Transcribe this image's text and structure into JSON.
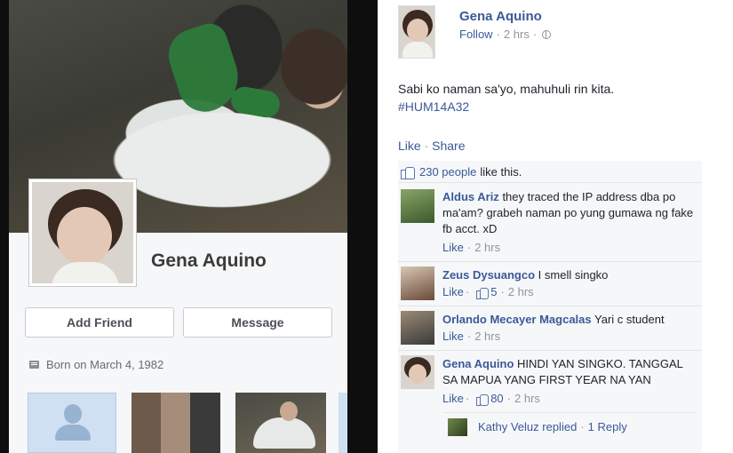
{
  "profile": {
    "name": "Gena Aquino",
    "add_friend": "Add Friend",
    "message": "Message",
    "born": "Born on March 4, 1982"
  },
  "post": {
    "author": "Gena Aquino",
    "follow": "Follow",
    "separator": "·",
    "time": "2 hrs",
    "text": "Sabi ko naman sa'yo, mahuhuli rin kita.",
    "hashtag": "#HUM14A32",
    "like": "Like",
    "share": "Share"
  },
  "likes": {
    "count": "230 people",
    "suffix": "like this."
  },
  "comments": [
    {
      "name": "Aldus Ariz",
      "text": "they traced the IP address dba po ma'am? grabeh naman po yung gumawa ng fake fb acct. xD",
      "like": "Like",
      "time": "2 hrs",
      "likes": ""
    },
    {
      "name": "Zeus Dysuangco",
      "text": "I smell singko",
      "like": "Like",
      "time": "2 hrs",
      "likes": "5"
    },
    {
      "name": "Orlando Mecayer Magcalas",
      "text": "Yari c student",
      "like": "Like",
      "time": "2 hrs",
      "likes": ""
    },
    {
      "name": "Gena Aquino",
      "text": "HINDI YAN SINGKO. TANGGAL SA MAPUA YANG FIRST YEAR NA YAN",
      "like": "Like",
      "time": "2 hrs",
      "likes": "80"
    }
  ],
  "reply": {
    "text": "Kathy Veluz replied",
    "count": "1 Reply"
  },
  "colors": {
    "link": "#3b5998",
    "meta": "#90949c",
    "panel": "#f6f7f9"
  }
}
